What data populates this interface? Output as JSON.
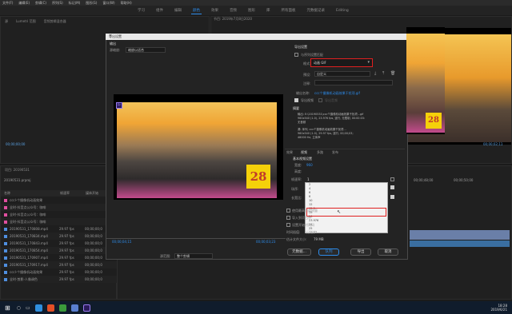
{
  "menubar": {
    "items": [
      "文件(F)",
      "编辑(E)",
      "剪辑(C)",
      "序列(S)",
      "标记(M)",
      "图形(G)",
      "窗口(W)",
      "帮助(H)"
    ]
  },
  "workspace_tabs": {
    "items": [
      "学习",
      "组件",
      "编辑",
      "颜色",
      "效果",
      "音频",
      "图形",
      "库",
      "所有面板",
      "元数据记录",
      "Editing"
    ],
    "active_index": 3
  },
  "source_panel": {
    "tab": "源",
    "tab2": "Lumetri 范围",
    "tab3": "音频剪辑混合器",
    "timecode": "00;00;00;00"
  },
  "program_panel": {
    "tab": "节目: 2019年7月8日2020",
    "timecode_right": "00;00;02;11"
  },
  "project_panel": {
    "title": "项目: 20190531",
    "file": "20190531.prproj",
    "headers": [
      "名称",
      "帧速率",
      "媒体开始"
    ],
    "rows": [
      {
        "name": "cccl-个摄像机动画效果",
        "rate": "",
        "start": ""
      },
      {
        "name": "全时-抖音点公众号：咖啡",
        "rate": "",
        "start": ""
      },
      {
        "name": "全时-抖音点公众号：咖啡",
        "rate": "",
        "start": ""
      },
      {
        "name": "全时-抖音点公众号：咖啡",
        "rate": "",
        "start": ""
      },
      {
        "name": "20190531_170808.mp4",
        "rate": "29.97 fps",
        "start": "00;00;00;0"
      },
      {
        "name": "20190531_170834.mp4",
        "rate": "29.97 fps",
        "start": "00;00;00;0"
      },
      {
        "name": "20190531_170843.mp4",
        "rate": "29.97 fps",
        "start": "00;00;00;0"
      },
      {
        "name": "20190531_170854.mp4",
        "rate": "29.97 fps",
        "start": "00;00;00;0"
      },
      {
        "name": "20190531_170907.mp4",
        "rate": "29.97 fps",
        "start": "00;00;00;0"
      },
      {
        "name": "20190531_170917.mp4",
        "rate": "29.97 fps",
        "start": "00;00;00;0"
      },
      {
        "name": "cccl-个摄像机动画效果",
        "rate": "29.97 fps",
        "start": "00;00;00;0"
      },
      {
        "name": "全时-剪影-人像调色",
        "rate": "29.97 fps",
        "start": "00;00;00;0"
      }
    ]
  },
  "timeline_panel": {
    "tab": "2019年7月8日",
    "tc1": "00;00;48;00",
    "tc2": "00;00;50;00"
  },
  "dialog": {
    "title": "导出设置",
    "left_tabs": [
      "输出"
    ],
    "source_scaling_label": "源缩放:",
    "source_scaling_value": "缩放以适合",
    "timecode_left": "00;00;04;15",
    "timecode_right": "00;00;03;23",
    "range_label": "源范围:",
    "range_value": "整个剪辑",
    "settings_heading": "导出设置",
    "match_sequence_label": "与序列设置匹配",
    "format_label": "格式:",
    "format_value": "动画 GIF",
    "preset_label": "预设:",
    "preset_value": "自定义",
    "comments_label": "注释:",
    "output_name_label": "输出名称:",
    "output_name_value": "ccc个摄像机动画效果干扰项.gif",
    "export_video_label": "导出视频",
    "export_audio_label": "导出音频",
    "summary_heading": "摘要",
    "summary_output": "输出: E:\\20190531\\ccc个摄像机动画效果干扰项...gif\n960x540 (1.0), 23.976 fps, 逐行, 无限制, 00:00:03:\n无音频",
    "summary_source": "源: 序列, ccc个摄像机动画效果干扰项...\n960x540 (1.0), 29.97 fps, 逐行, 00;00;03;\n48000 Hz, 立体声",
    "right_tabs": [
      "效果",
      "视频",
      "多路",
      "发布"
    ],
    "right_tab_active": 1,
    "basic_video": "基本视频设置",
    "width_label": "宽度:",
    "width_value": "960",
    "height_label": "高度:",
    "framerate_label": "帧速率:",
    "framerate_value": "1",
    "dropdown_options": [
      "2",
      "4",
      "6",
      "8",
      "10",
      "12",
      "12.5",
      "15",
      "20",
      "23.976",
      "24",
      "25",
      "29.97"
    ],
    "dropdown_highlight": "23.976",
    "field_label": "场序:",
    "aspect_label": "长宽比:",
    "render_max_label": "使用最高渲染质量",
    "use_preview_label": "使用预览",
    "import_project_label": "导入到项目中",
    "set_start_tc_label": "设置开始时间码",
    "time_interp_label": "时间插值:",
    "time_interp_value": "帧采样",
    "file_size_label": "估计文件大小:",
    "file_size_value": "79 MB",
    "metadata_button": "元数据...",
    "queue_button": "队列",
    "export_button": "导出",
    "cancel_button": "取消",
    "seal_text": "28"
  },
  "taskbar": {
    "time": "18:28",
    "date": "2019/6/21"
  }
}
